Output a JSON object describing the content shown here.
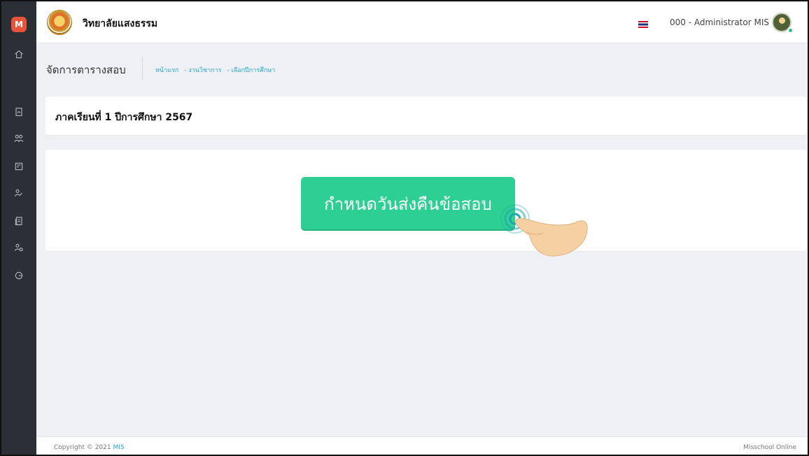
{
  "sidebar": {
    "brand_letter": "M",
    "items": [
      {
        "icon": "home-icon"
      },
      {
        "icon": "document-icon"
      },
      {
        "icon": "users-icon"
      },
      {
        "icon": "calendar-icon"
      },
      {
        "icon": "edit-user-icon"
      },
      {
        "icon": "book-icon"
      },
      {
        "icon": "user-settings-icon"
      },
      {
        "icon": "logout-icon"
      }
    ]
  },
  "header": {
    "school_name": "วิทยาลัยแสงธรรม",
    "user_name": "000 - Administrator MIS",
    "online_status_color": "#1ec783"
  },
  "page": {
    "title": "จัดการตารางสอบ",
    "breadcrumb": [
      "หน้าแรก",
      "- งานวิชาการ",
      "- เลือกปีการศึกษา"
    ]
  },
  "semester": {
    "title": "ภาคเรียนที่ 1 ปีการศึกษา 2567"
  },
  "action": {
    "button_label": "กำหนดวันส่งคืนข้อสอบ",
    "button_color": "#2ecf92"
  },
  "footer": {
    "copyright_prefix": "Copyright © 2021",
    "copyright_brand": "MIS",
    "right_text": "Misschool Online"
  }
}
